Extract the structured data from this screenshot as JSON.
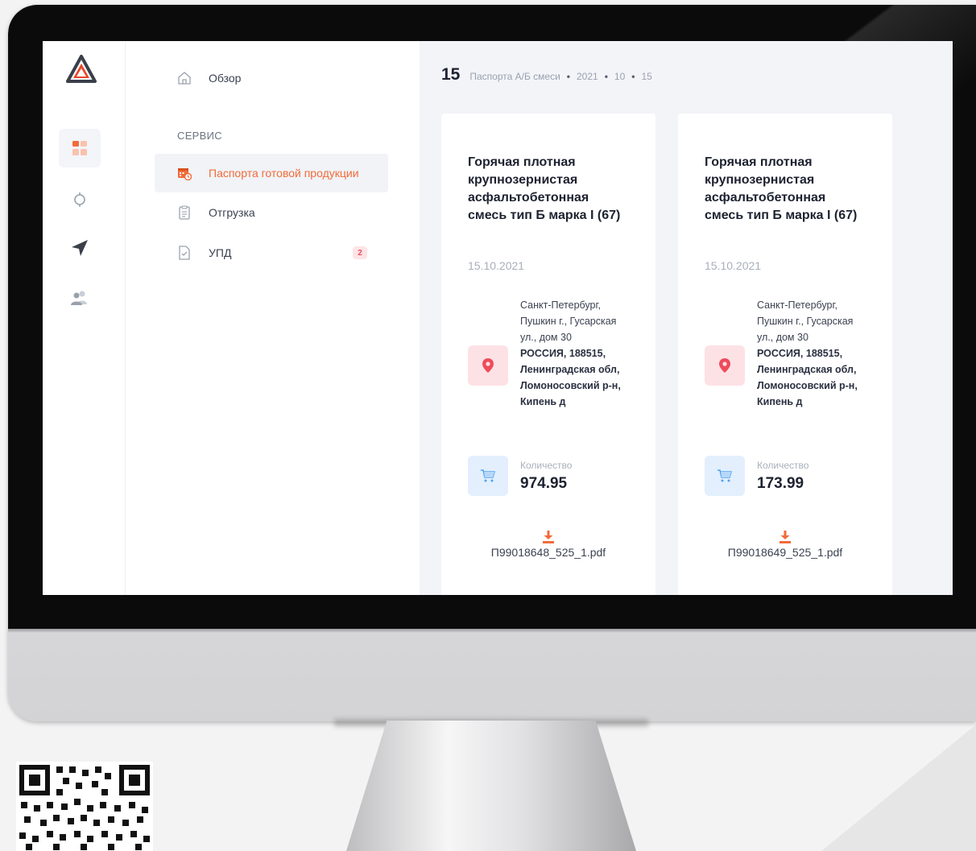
{
  "breadcrumb": {
    "count": "15",
    "section": "Паспорта А/Б смеси",
    "year": "2021",
    "month": "10",
    "day": "15"
  },
  "rail": {
    "icons": [
      "logo-icon",
      "dashboard-icon",
      "target-icon",
      "send-icon",
      "users-icon"
    ]
  },
  "sidebar": {
    "overview_label": "Обзор",
    "section_label": "СЕРВИС",
    "items": [
      {
        "label": "Паспорта готовой продукции",
        "icon": "calendar-clock-icon",
        "active": true
      },
      {
        "label": "Отгрузка",
        "icon": "clipboard-icon"
      },
      {
        "label": "УПД",
        "icon": "document-check-icon",
        "badge": "2"
      }
    ]
  },
  "cards": [
    {
      "title": "Горячая плотная крупнозернистая асфальтобетонная смесь тип Б марка I (67)",
      "date": "15.10.2021",
      "address_line1": "Санкт-Петербург, Пушкин г., Гусарская ул., дом 30",
      "address_line2": "РОССИЯ, 188515, Ленинградская обл, Ломоносовский р-н, Кипень д",
      "quantity_label": "Количество",
      "quantity_value": "974.95",
      "file": "П99018648_525_1.pdf"
    },
    {
      "title": "Горячая плотная крупнозернистая асфальтобетонная смесь тип Б марка I (67)",
      "date": "15.10.2021",
      "address_line1": "Санкт-Петербург, Пушкин г., Гусарская ул., дом 30",
      "address_line2": "РОССИЯ, 188515, Ленинградская обл, Ломоносовский р-н, Кипень д",
      "quantity_label": "Количество",
      "quantity_value": "173.99",
      "file": "П99018649_525_1.pdf"
    }
  ],
  "colors": {
    "accent": "#f26b3a",
    "badge_bg": "#fde4e6",
    "badge_text": "#e8505b",
    "location_bg": "#fde2e5",
    "location_pin": "#ef4b5c",
    "cart_bg": "#e3effd",
    "cart_icon": "#4fa3f0",
    "download": "#f26b3a"
  }
}
